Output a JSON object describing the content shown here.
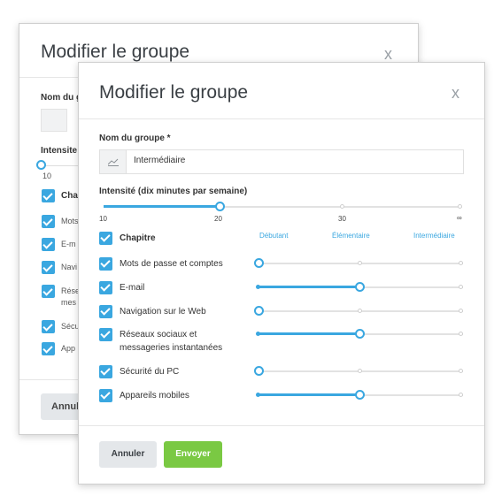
{
  "back_dialog": {
    "title": "Modifier le groupe",
    "close": "x",
    "group_label": "Nom du g",
    "intensity_label": "Intensite",
    "tick_min": "10",
    "rows": [
      "Cha",
      "Mots",
      "E-m",
      "Navi",
      "Rése",
      "mes",
      "Sécu",
      "App"
    ],
    "cancel": "Annul"
  },
  "dialog": {
    "title": "Modifier le groupe",
    "close": "x",
    "group_name_label": "Nom du groupe *",
    "group_name_value": "Intermédiaire",
    "intensity_label": "Intensité (dix minutes par semaine)",
    "intensity_ticks": [
      "10",
      "20",
      "30",
      "∞"
    ],
    "intensity_value": 20,
    "chapter_header": "Chapitre",
    "levels": [
      "Débutant",
      "Élémentaire",
      "Intermédiaire"
    ],
    "chapters": [
      {
        "line1": "Mots de passe et comptes",
        "line2": "",
        "checked": true,
        "level": "Débutant"
      },
      {
        "line1": "E-mail",
        "line2": "",
        "checked": true,
        "level": "Élémentaire"
      },
      {
        "line1": "Navigation sur le Web",
        "line2": "",
        "checked": true,
        "level": "Débutant"
      },
      {
        "line1": "Réseaux sociaux et",
        "line2": "messageries instantanées",
        "checked": true,
        "level": "Élémentaire"
      },
      {
        "line1": "Sécurité du PC",
        "line2": "",
        "checked": true,
        "level": "Débutant"
      },
      {
        "line1": "Appareils mobiles",
        "line2": "",
        "checked": true,
        "level": "Élémentaire"
      }
    ],
    "cancel_label": "Annuler",
    "send_label": "Envoyer"
  },
  "colors": {
    "accent": "#3aa7e0",
    "send": "#7ac943",
    "cancel_bg": "#e4e7ea"
  }
}
